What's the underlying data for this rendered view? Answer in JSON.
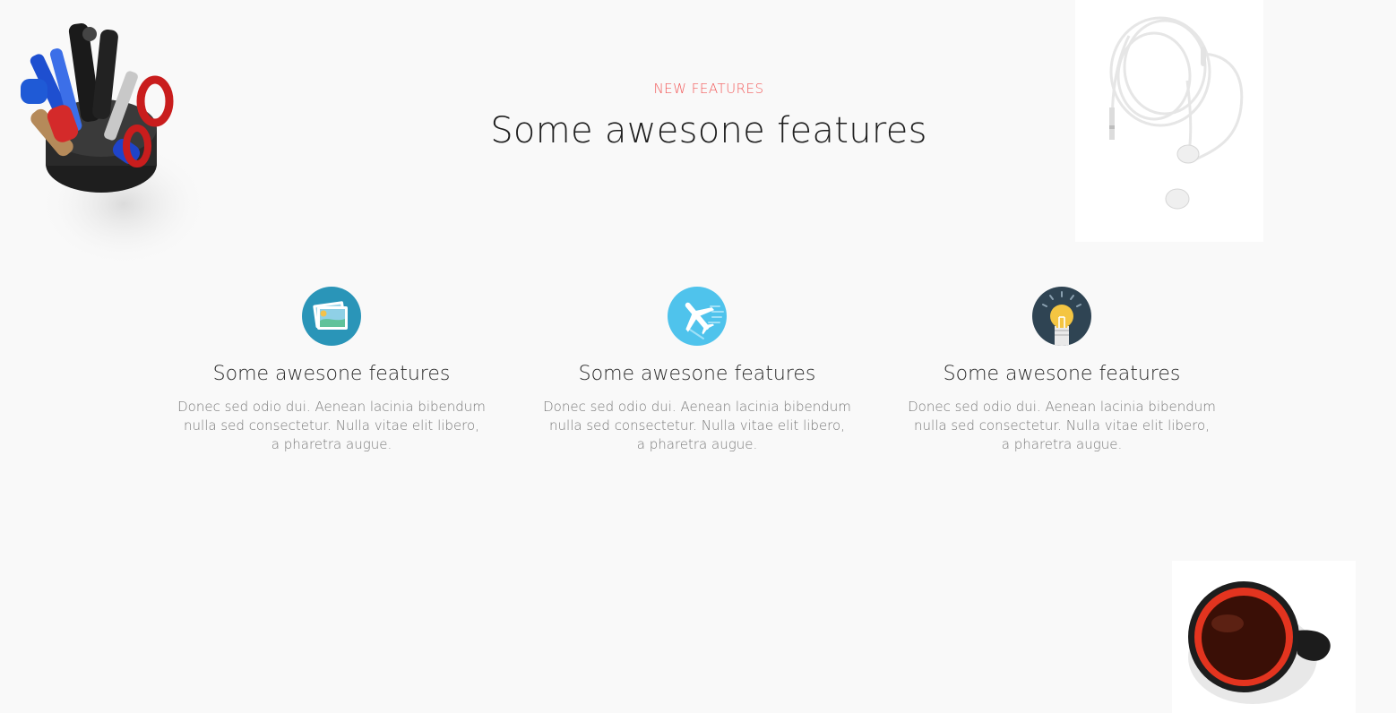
{
  "header": {
    "eyebrow": "NEW FEATURES",
    "title": "Some awesone features"
  },
  "features": [
    {
      "icon": "photos-icon",
      "title": "Some awesone features",
      "line1": "Donec sed odio dui. Aenean lacinia bibendum",
      "line2": "nulla sed consectetur. Nulla vitae elit libero,",
      "line3": "a pharetra augue."
    },
    {
      "icon": "airplane-icon",
      "title": "Some awesone features",
      "line1": "Donec sed odio dui. Aenean lacinia bibendum",
      "line2": "nulla sed consectetur. Nulla vitae elit libero,",
      "line3": "a pharetra augue."
    },
    {
      "icon": "lightbulb-icon",
      "title": "Some awesone features",
      "line1": "Donec sed odio dui. Aenean lacinia bibendum",
      "line2": "nulla sed consectetur. Nulla vitae elit libero,",
      "line3": "a pharetra augue."
    }
  ],
  "colors": {
    "background": "#f9f9f9",
    "accent": "#f25a5a",
    "photos_circle": "#2a95b8",
    "airplane_circle": "#4fc3ec",
    "lightbulb_circle": "#2f4453",
    "bulb": "#f4c542"
  }
}
